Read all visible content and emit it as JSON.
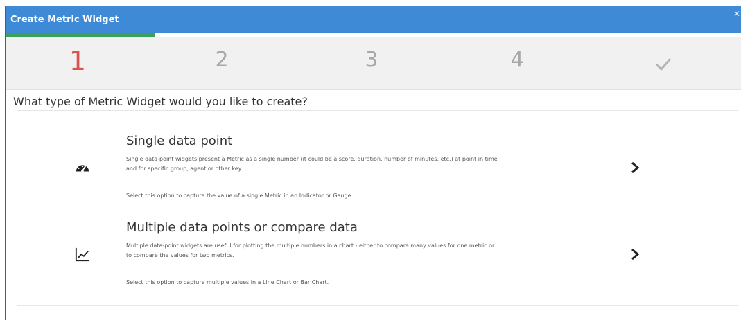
{
  "dialog": {
    "title": "Create Metric Widget",
    "close_icon": "close-icon",
    "accent_color": "#3f8ad6"
  },
  "wizard": {
    "steps": [
      "1",
      "2",
      "3",
      "4"
    ],
    "done_icon": "checkmark-icon",
    "active_step": "1",
    "active_color": "#d9534f",
    "progress_color": "#3aa05a"
  },
  "question": "What type of Metric Widget would you like to create?",
  "options": [
    {
      "title": "Single data point",
      "icon": "gauge-icon",
      "description_line1": "Single data-point widgets present a Metric as a single number (it could be a score, duration, number of minutes, etc.) at point in time",
      "description_line2": "and for specific group, agent or other key.",
      "select_note": "Select this option to capture the value of a single Metric in an Indicator or Gauge."
    },
    {
      "title": "Multiple data points or compare data",
      "icon": "line-chart-icon",
      "description_line1": "Multiple data-point widgets are useful for plotting the multiple numbers in a chart - either to compare many values for one metric or",
      "description_line2": "to compare the values for two metrics.",
      "select_note": "Select this option to capture multiple values in a Line Chart or Bar Chart."
    }
  ]
}
